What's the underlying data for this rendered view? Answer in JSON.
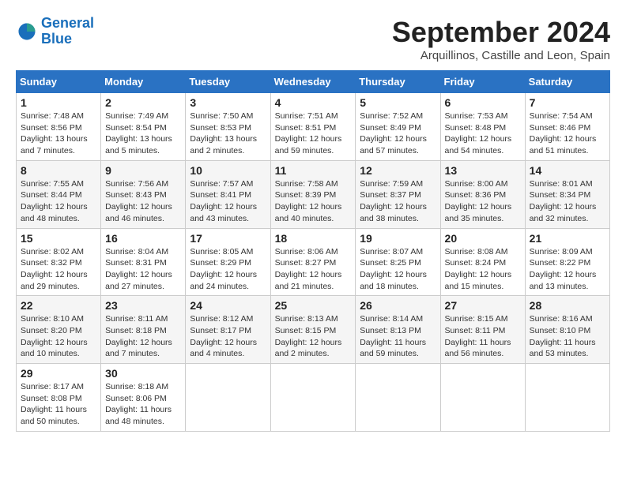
{
  "logo": {
    "line1": "General",
    "line2": "Blue"
  },
  "title": "September 2024",
  "subtitle": "Arquillinos, Castille and Leon, Spain",
  "days_header": [
    "Sunday",
    "Monday",
    "Tuesday",
    "Wednesday",
    "Thursday",
    "Friday",
    "Saturday"
  ],
  "weeks": [
    [
      {
        "day": "1",
        "info": "Sunrise: 7:48 AM\nSunset: 8:56 PM\nDaylight: 13 hours and 7 minutes."
      },
      {
        "day": "2",
        "info": "Sunrise: 7:49 AM\nSunset: 8:54 PM\nDaylight: 13 hours and 5 minutes."
      },
      {
        "day": "3",
        "info": "Sunrise: 7:50 AM\nSunset: 8:53 PM\nDaylight: 13 hours and 2 minutes."
      },
      {
        "day": "4",
        "info": "Sunrise: 7:51 AM\nSunset: 8:51 PM\nDaylight: 12 hours and 59 minutes."
      },
      {
        "day": "5",
        "info": "Sunrise: 7:52 AM\nSunset: 8:49 PM\nDaylight: 12 hours and 57 minutes."
      },
      {
        "day": "6",
        "info": "Sunrise: 7:53 AM\nSunset: 8:48 PM\nDaylight: 12 hours and 54 minutes."
      },
      {
        "day": "7",
        "info": "Sunrise: 7:54 AM\nSunset: 8:46 PM\nDaylight: 12 hours and 51 minutes."
      }
    ],
    [
      {
        "day": "8",
        "info": "Sunrise: 7:55 AM\nSunset: 8:44 PM\nDaylight: 12 hours and 48 minutes."
      },
      {
        "day": "9",
        "info": "Sunrise: 7:56 AM\nSunset: 8:43 PM\nDaylight: 12 hours and 46 minutes."
      },
      {
        "day": "10",
        "info": "Sunrise: 7:57 AM\nSunset: 8:41 PM\nDaylight: 12 hours and 43 minutes."
      },
      {
        "day": "11",
        "info": "Sunrise: 7:58 AM\nSunset: 8:39 PM\nDaylight: 12 hours and 40 minutes."
      },
      {
        "day": "12",
        "info": "Sunrise: 7:59 AM\nSunset: 8:37 PM\nDaylight: 12 hours and 38 minutes."
      },
      {
        "day": "13",
        "info": "Sunrise: 8:00 AM\nSunset: 8:36 PM\nDaylight: 12 hours and 35 minutes."
      },
      {
        "day": "14",
        "info": "Sunrise: 8:01 AM\nSunset: 8:34 PM\nDaylight: 12 hours and 32 minutes."
      }
    ],
    [
      {
        "day": "15",
        "info": "Sunrise: 8:02 AM\nSunset: 8:32 PM\nDaylight: 12 hours and 29 minutes."
      },
      {
        "day": "16",
        "info": "Sunrise: 8:04 AM\nSunset: 8:31 PM\nDaylight: 12 hours and 27 minutes."
      },
      {
        "day": "17",
        "info": "Sunrise: 8:05 AM\nSunset: 8:29 PM\nDaylight: 12 hours and 24 minutes."
      },
      {
        "day": "18",
        "info": "Sunrise: 8:06 AM\nSunset: 8:27 PM\nDaylight: 12 hours and 21 minutes."
      },
      {
        "day": "19",
        "info": "Sunrise: 8:07 AM\nSunset: 8:25 PM\nDaylight: 12 hours and 18 minutes."
      },
      {
        "day": "20",
        "info": "Sunrise: 8:08 AM\nSunset: 8:24 PM\nDaylight: 12 hours and 15 minutes."
      },
      {
        "day": "21",
        "info": "Sunrise: 8:09 AM\nSunset: 8:22 PM\nDaylight: 12 hours and 13 minutes."
      }
    ],
    [
      {
        "day": "22",
        "info": "Sunrise: 8:10 AM\nSunset: 8:20 PM\nDaylight: 12 hours and 10 minutes."
      },
      {
        "day": "23",
        "info": "Sunrise: 8:11 AM\nSunset: 8:18 PM\nDaylight: 12 hours and 7 minutes."
      },
      {
        "day": "24",
        "info": "Sunrise: 8:12 AM\nSunset: 8:17 PM\nDaylight: 12 hours and 4 minutes."
      },
      {
        "day": "25",
        "info": "Sunrise: 8:13 AM\nSunset: 8:15 PM\nDaylight: 12 hours and 2 minutes."
      },
      {
        "day": "26",
        "info": "Sunrise: 8:14 AM\nSunset: 8:13 PM\nDaylight: 11 hours and 59 minutes."
      },
      {
        "day": "27",
        "info": "Sunrise: 8:15 AM\nSunset: 8:11 PM\nDaylight: 11 hours and 56 minutes."
      },
      {
        "day": "28",
        "info": "Sunrise: 8:16 AM\nSunset: 8:10 PM\nDaylight: 11 hours and 53 minutes."
      }
    ],
    [
      {
        "day": "29",
        "info": "Sunrise: 8:17 AM\nSunset: 8:08 PM\nDaylight: 11 hours and 50 minutes."
      },
      {
        "day": "30",
        "info": "Sunrise: 8:18 AM\nSunset: 8:06 PM\nDaylight: 11 hours and 48 minutes."
      },
      null,
      null,
      null,
      null,
      null
    ]
  ]
}
